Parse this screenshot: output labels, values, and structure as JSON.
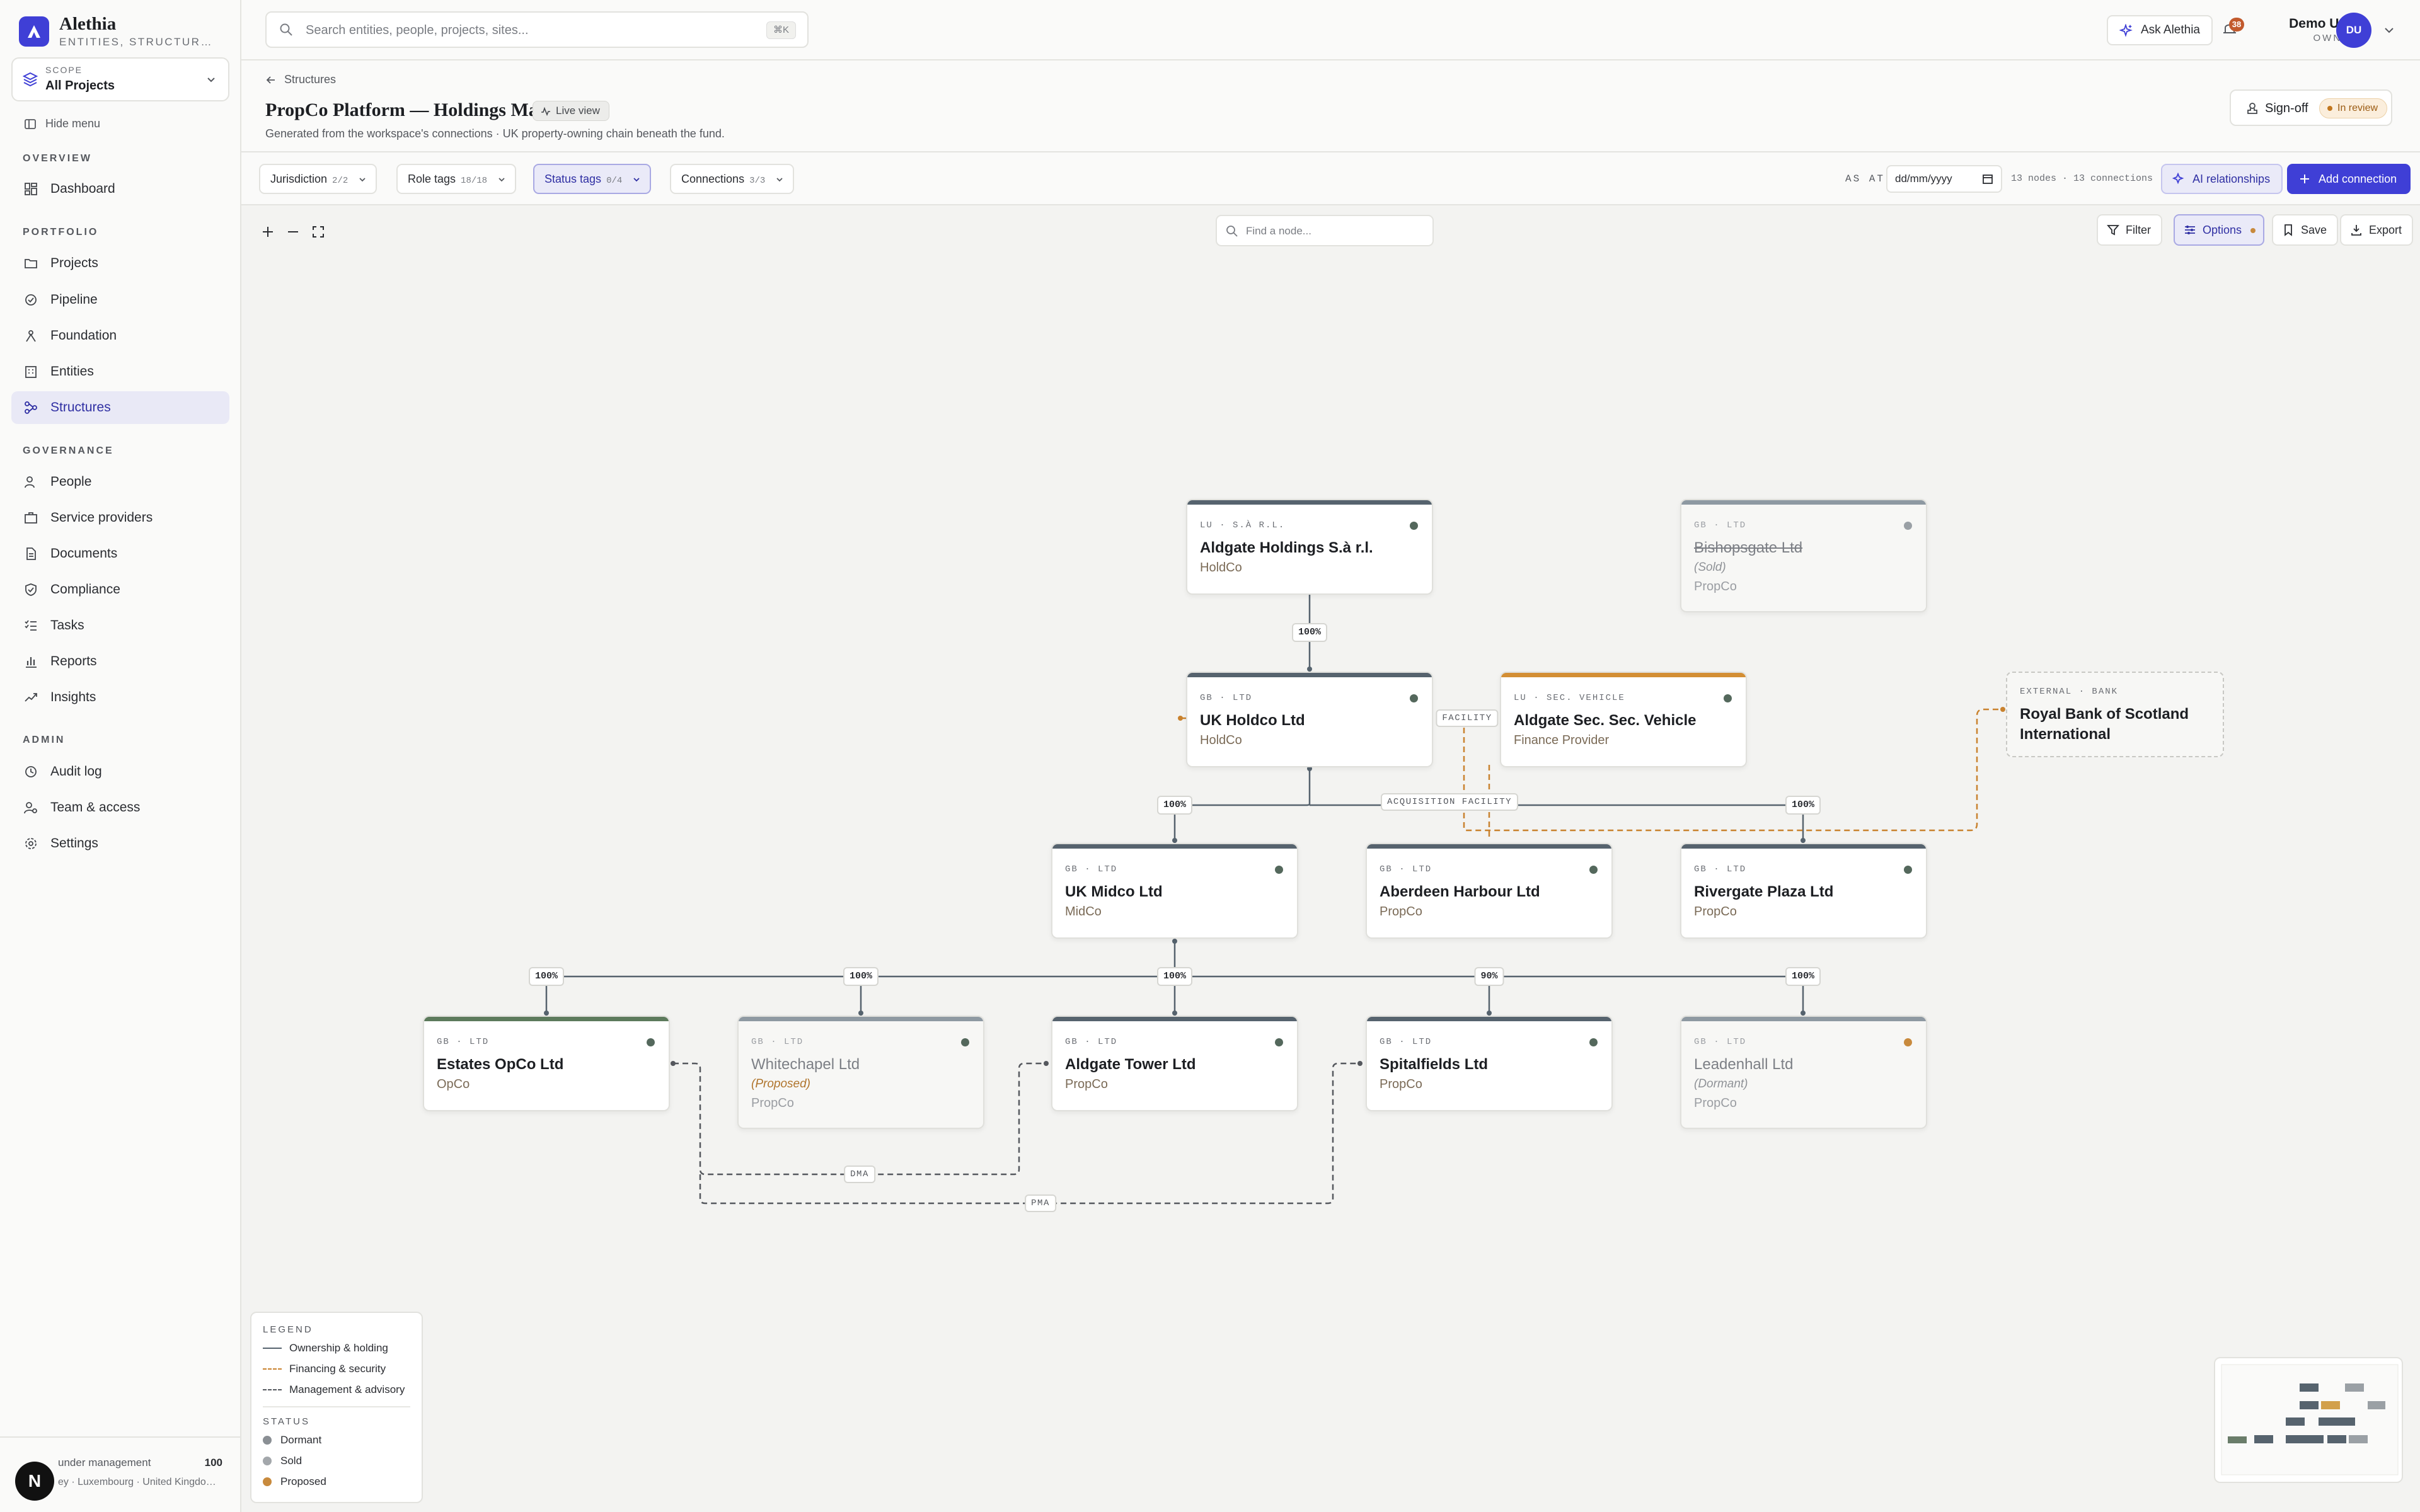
{
  "brand": {
    "name": "Alethia",
    "subtitle": "ENTITIES, STRUCTURES …"
  },
  "scope": {
    "label": "SCOPE",
    "value": "All Projects"
  },
  "sidebar": {
    "hide_menu": "Hide menu",
    "sections": {
      "overview": "OVERVIEW",
      "portfolio": "PORTFOLIO",
      "governance": "GOVERNANCE",
      "admin": "ADMIN"
    },
    "items": {
      "dashboard": "Dashboard",
      "projects": "Projects",
      "pipeline": "Pipeline",
      "foundation": "Foundation",
      "entities": "Entities",
      "structures": "Structures",
      "people": "People",
      "service_providers": "Service providers",
      "documents": "Documents",
      "compliance": "Compliance",
      "tasks": "Tasks",
      "reports": "Reports",
      "insights": "Insights",
      "audit_log": "Audit log",
      "team_access": "Team & access",
      "settings": "Settings"
    },
    "footer": {
      "label": "under management",
      "value": "100",
      "jurisdictions": "ey · Luxembourg · United Kingdo…",
      "badge": "N"
    }
  },
  "topbar": {
    "search_placeholder": "Search entities, people, projects, sites...",
    "search_shortcut": "⌘K",
    "ask_label": "Ask Alethia",
    "notif_count": "38",
    "user_name": "Demo User",
    "user_role": "OWNER",
    "avatar_initials": "DU"
  },
  "page": {
    "breadcrumb": "Structures",
    "title": "PropCo Platform — Holdings Map",
    "live_label": "Live view",
    "subtitle": "Generated from the workspace's connections · UK property-owning chain beneath the fund.",
    "signoff_label": "Sign-off",
    "review_status": "In review"
  },
  "filters": {
    "jurisdiction": {
      "label": "Jurisdiction",
      "count": "2/2"
    },
    "role_tags": {
      "label": "Role tags",
      "count": "18/18"
    },
    "status_tags": {
      "label": "Status tags",
      "count": "0/4"
    },
    "connections": {
      "label": "Connections",
      "count": "3/3"
    },
    "as_at_label": "AS AT",
    "date_placeholder": "dd/mm/yyyy",
    "node_count": "13 nodes",
    "connection_count": "13 connections",
    "ai_relationships": "AI relationships",
    "add_connection": "Add connection"
  },
  "canvas": {
    "find_placeholder": "Find a node...",
    "filter_label": "Filter",
    "options_label": "Options",
    "save_label": "Save",
    "export_label": "Export"
  },
  "nodes": {
    "aldgate_holdings": {
      "meta": "LU · S.À R.L.",
      "name": "Aldgate Holdings S.à r.l.",
      "role": "HoldCo"
    },
    "bishopsgate": {
      "meta": "GB · LTD",
      "name": "Bishopsgate Ltd",
      "note": "(Sold)",
      "role": "PropCo"
    },
    "uk_holdco": {
      "meta": "GB · LTD",
      "name": "UK Holdco Ltd",
      "role": "HoldCo"
    },
    "aldgate_sec": {
      "meta": "LU · SEC. VEHICLE",
      "name": "Aldgate Sec. Sec. Vehicle",
      "role": "Finance Provider"
    },
    "rbs": {
      "meta": "EXTERNAL · BANK",
      "name": "Royal Bank of Scotland International"
    },
    "uk_midco": {
      "meta": "GB · LTD",
      "name": "UK Midco Ltd",
      "role": "MidCo"
    },
    "aberdeen": {
      "meta": "GB · LTD",
      "name": "Aberdeen Harbour Ltd",
      "role": "PropCo"
    },
    "rivergate": {
      "meta": "GB · LTD",
      "name": "Rivergate Plaza Ltd",
      "role": "PropCo"
    },
    "estates_opco": {
      "meta": "GB · LTD",
      "name": "Estates OpCo Ltd",
      "role": "OpCo"
    },
    "whitechapel": {
      "meta": "GB · LTD",
      "name": "Whitechapel Ltd",
      "note": "(Proposed)",
      "role": "PropCo"
    },
    "aldgate_tower": {
      "meta": "GB · LTD",
      "name": "Aldgate Tower Ltd",
      "role": "PropCo"
    },
    "spitalfields": {
      "meta": "GB · LTD",
      "name": "Spitalfields Ltd",
      "role": "PropCo"
    },
    "leadenhall": {
      "meta": "GB · LTD",
      "name": "Leadenhall Ltd",
      "note": "(Dormant)",
      "role": "PropCo"
    }
  },
  "edges": {
    "holdings_to_holdco": "100%",
    "holdco_to_midco": "100%",
    "holdco_to_rivergate": "100%",
    "midco_to_estates": "100%",
    "midco_to_whitechapel": "100%",
    "midco_to_tower": "100%",
    "midco_to_spitalfields": "90%",
    "midco_to_leadenhall": "100%",
    "facility": "FACILITY",
    "acquisition_facility": "ACQUISITION FACILITY",
    "dma": "DMA",
    "pma": "PMA"
  },
  "legend": {
    "title": "LEGEND",
    "ownership": "Ownership & holding",
    "financing": "Financing & security",
    "management": "Management & advisory",
    "status_title": "STATUS",
    "dormant": "Dormant",
    "sold": "Sold",
    "proposed": "Proposed"
  },
  "colors": {
    "accent": "#3f3fd6",
    "ownership_line": "#56636e",
    "financing_line": "#c9822e",
    "management_line": "#55585e",
    "status_dormant": "#8a8f94",
    "status_sold": "#a3a7ab",
    "status_proposed": "#c88a3d"
  }
}
